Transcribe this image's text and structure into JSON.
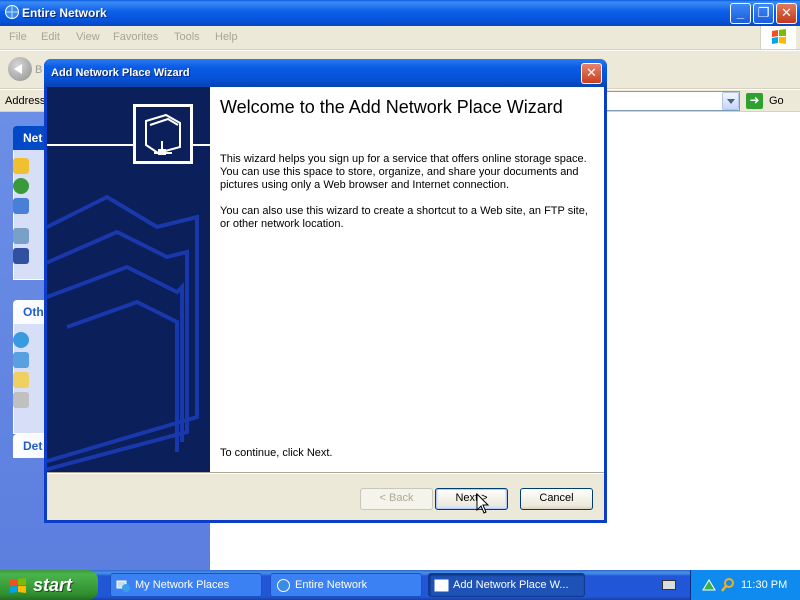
{
  "explorer": {
    "title": "Entire Network",
    "menu": [
      "File",
      "Edit",
      "View",
      "Favorites",
      "Tools",
      "Help"
    ],
    "back_label": "B",
    "address_label": "Address",
    "go_label": "Go",
    "taskpane": {
      "box1_head": "Net",
      "box2_head": "Oth",
      "box3_head": "Det"
    }
  },
  "dialog": {
    "title": "Add Network Place Wizard",
    "close_label": "✕",
    "heading": "Welcome to the Add Network Place Wizard",
    "para1": "This wizard helps you sign up for a service that offers online storage space. You can use this space to store, organize, and share your documents and pictures using only a Web browser and Internet connection.",
    "para2": "You can also use this wizard to create a shortcut to a Web site, an FTP site, or other network location.",
    "continue_text": "To continue, click Next.",
    "buttons": {
      "back": "< Back",
      "next": "Next >",
      "cancel": "Cancel"
    }
  },
  "taskbar": {
    "start_label": "start",
    "tasks": [
      {
        "label": "My Network Places"
      },
      {
        "label": "Entire Network"
      },
      {
        "label": "Add Network Place W..."
      }
    ],
    "clock": "11:30 PM"
  },
  "colors": {
    "xp_blue": "#0552d8",
    "start_green": "#3c9a3c",
    "wizard_sidebar": "#0b1f5a",
    "taskpane_blue": "#6b8ee6"
  }
}
